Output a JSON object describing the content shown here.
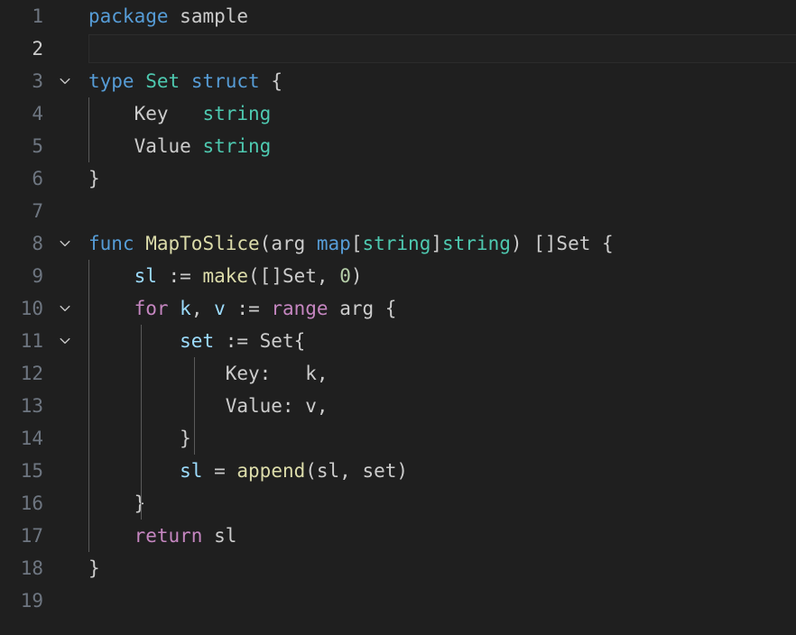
{
  "editor": {
    "name": "code-editor",
    "language": "go",
    "theme": "dark-modern",
    "background_color": "#1f1f1f",
    "active_line": 2,
    "total_lines": 19,
    "gutter": {
      "line_number_color": "#6e7681",
      "active_line_number_color": "#cccccc",
      "line_numbers": [
        "1",
        "2",
        "3",
        "4",
        "5",
        "6",
        "7",
        "8",
        "9",
        "10",
        "11",
        "12",
        "13",
        "14",
        "15",
        "16",
        "17",
        "18",
        "19"
      ]
    },
    "fold_icons": {
      "expanded_lines": [
        3,
        8,
        10,
        11
      ],
      "icon_name": "chevron-down-icon"
    },
    "syntax_colors": {
      "keyword": "#569cd6",
      "control": "#c586c0",
      "type": "#4ec9b0",
      "function": "#dcdcaa",
      "variable": "#9cdcfe",
      "number": "#b5cea8",
      "plain": "#cccccc"
    },
    "lines": [
      {
        "n": "1",
        "text": "package sample",
        "tokens": [
          {
            "t": "package",
            "c": "t-kw"
          },
          {
            "t": " ",
            "c": "t-plain"
          },
          {
            "t": "sample",
            "c": "t-plain"
          }
        ]
      },
      {
        "n": "2",
        "text": "",
        "tokens": []
      },
      {
        "n": "3",
        "text": "type Set struct {",
        "tokens": [
          {
            "t": "type",
            "c": "t-kw"
          },
          {
            "t": " ",
            "c": "t-plain"
          },
          {
            "t": "Set",
            "c": "t-type"
          },
          {
            "t": " ",
            "c": "t-plain"
          },
          {
            "t": "struct",
            "c": "t-kw"
          },
          {
            "t": " {",
            "c": "t-plain"
          }
        ]
      },
      {
        "n": "4",
        "text": "    Key   string",
        "tokens": [
          {
            "t": "    Key   ",
            "c": "t-plain"
          },
          {
            "t": "string",
            "c": "t-type"
          }
        ]
      },
      {
        "n": "5",
        "text": "    Value string",
        "tokens": [
          {
            "t": "    Value ",
            "c": "t-plain"
          },
          {
            "t": "string",
            "c": "t-type"
          }
        ]
      },
      {
        "n": "6",
        "text": "}",
        "tokens": [
          {
            "t": "}",
            "c": "t-plain"
          }
        ]
      },
      {
        "n": "7",
        "text": "",
        "tokens": []
      },
      {
        "n": "8",
        "text": "func MapToSlice(arg map[string]string) []Set {",
        "tokens": [
          {
            "t": "func",
            "c": "t-kw"
          },
          {
            "t": " ",
            "c": "t-plain"
          },
          {
            "t": "MapToSlice",
            "c": "t-fn"
          },
          {
            "t": "(arg ",
            "c": "t-plain"
          },
          {
            "t": "map",
            "c": "t-kw"
          },
          {
            "t": "[",
            "c": "t-plain"
          },
          {
            "t": "string",
            "c": "t-type"
          },
          {
            "t": "]",
            "c": "t-plain"
          },
          {
            "t": "string",
            "c": "t-type"
          },
          {
            "t": ") []Set {",
            "c": "t-plain"
          }
        ]
      },
      {
        "n": "9",
        "text": "    sl := make([]Set, 0)",
        "tokens": [
          {
            "t": "    ",
            "c": "t-plain"
          },
          {
            "t": "sl",
            "c": "t-var"
          },
          {
            "t": " := ",
            "c": "t-plain"
          },
          {
            "t": "make",
            "c": "t-fn"
          },
          {
            "t": "([]Set, ",
            "c": "t-plain"
          },
          {
            "t": "0",
            "c": "t-num"
          },
          {
            "t": ")",
            "c": "t-plain"
          }
        ]
      },
      {
        "n": "10",
        "text": "    for k, v := range arg {",
        "tokens": [
          {
            "t": "    ",
            "c": "t-plain"
          },
          {
            "t": "for",
            "c": "t-ctrl"
          },
          {
            "t": " ",
            "c": "t-plain"
          },
          {
            "t": "k",
            "c": "t-var"
          },
          {
            "t": ", ",
            "c": "t-plain"
          },
          {
            "t": "v",
            "c": "t-var"
          },
          {
            "t": " := ",
            "c": "t-plain"
          },
          {
            "t": "range",
            "c": "t-ctrl"
          },
          {
            "t": " arg {",
            "c": "t-plain"
          }
        ]
      },
      {
        "n": "11",
        "text": "        set := Set{",
        "tokens": [
          {
            "t": "        ",
            "c": "t-plain"
          },
          {
            "t": "set",
            "c": "t-var"
          },
          {
            "t": " := Set{",
            "c": "t-plain"
          }
        ]
      },
      {
        "n": "12",
        "text": "            Key:   k,",
        "tokens": [
          {
            "t": "            Key:   k,",
            "c": "t-plain"
          }
        ]
      },
      {
        "n": "13",
        "text": "            Value: v,",
        "tokens": [
          {
            "t": "            Value: v,",
            "c": "t-plain"
          }
        ]
      },
      {
        "n": "14",
        "text": "        }",
        "tokens": [
          {
            "t": "        }",
            "c": "t-plain"
          }
        ]
      },
      {
        "n": "15",
        "text": "        sl = append(sl, set)",
        "tokens": [
          {
            "t": "        ",
            "c": "t-plain"
          },
          {
            "t": "sl",
            "c": "t-var"
          },
          {
            "t": " = ",
            "c": "t-plain"
          },
          {
            "t": "append",
            "c": "t-fn"
          },
          {
            "t": "(sl, set)",
            "c": "t-plain"
          }
        ]
      },
      {
        "n": "16",
        "text": "    }",
        "tokens": [
          {
            "t": "    }",
            "c": "t-plain"
          }
        ]
      },
      {
        "n": "17",
        "text": "    return sl",
        "tokens": [
          {
            "t": "    ",
            "c": "t-plain"
          },
          {
            "t": "return",
            "c": "t-ctrl"
          },
          {
            "t": " sl",
            "c": "t-plain"
          }
        ]
      },
      {
        "n": "18",
        "text": "}",
        "tokens": [
          {
            "t": "}",
            "c": "t-plain"
          }
        ]
      },
      {
        "n": "19",
        "text": "",
        "tokens": []
      }
    ],
    "indent_guides": {
      "color": "#5a5a5a",
      "level_x": [
        0,
        58,
        117
      ],
      "per_line": [
        [],
        [],
        [],
        [
          0
        ],
        [
          0
        ],
        [],
        [],
        [],
        [
          0
        ],
        [
          0
        ],
        [
          0,
          58
        ],
        [
          0,
          58,
          117
        ],
        [
          0,
          58,
          117
        ],
        [
          0,
          58,
          117
        ],
        [
          0,
          58
        ],
        [
          0,
          58
        ],
        [
          0
        ],
        [],
        []
      ]
    }
  }
}
